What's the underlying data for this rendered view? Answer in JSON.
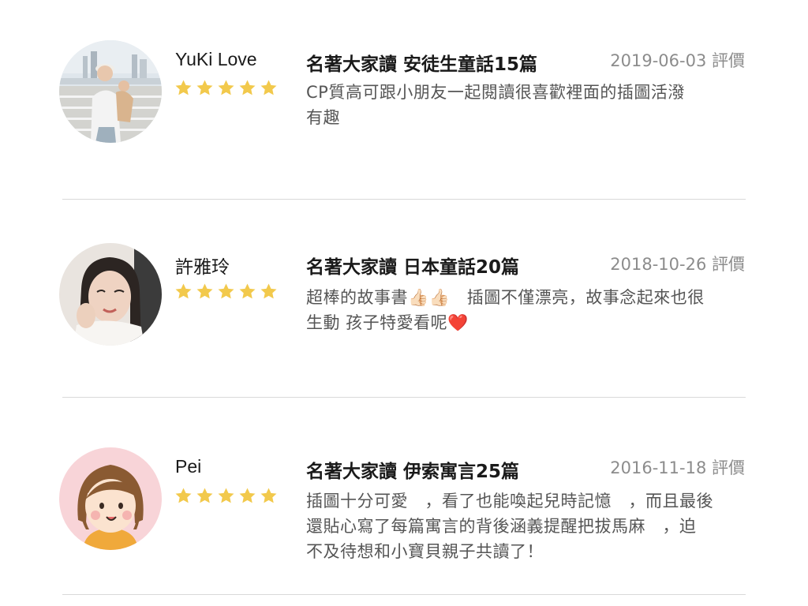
{
  "reviews": [
    {
      "reviewer": "YuKi Love",
      "rating": 5,
      "max_rating": 5,
      "product": "名著大家讀 安徒生童話15篇",
      "date": "2019-06-03",
      "date_suffix": "評價",
      "comment_lines": [
        "CP質高可跟小朋友一起閱讀很喜歡裡面的插圖活潑",
        "有趣"
      ],
      "avatar": "user-photo-woman-holding-child"
    },
    {
      "reviewer": "許雅玲",
      "rating": 5,
      "max_rating": 5,
      "product": "名著大家讀 日本童話20篇",
      "date": "2018-10-26",
      "date_suffix": "評價",
      "comment_lines": [
        "超棒的故事書👍🏻👍🏻　插圖不僅漂亮，故事念起來也很",
        "生動 孩子特愛看呢❤️"
      ],
      "avatar": "user-photo-woman-smiling"
    },
    {
      "reviewer": "Pei",
      "rating": 5,
      "max_rating": 5,
      "product": "名著大家讀 伊索寓言25篇",
      "date": "2016-11-18",
      "date_suffix": "評價",
      "comment_lines": [
        "插圖十分可愛　，看了也能喚起兒時記憶　，而且最後",
        "還貼心寫了每篇寓言的背後涵義提醒把拔馬麻　，迫",
        "不及待想和小寶貝親子共讀了！"
      ],
      "avatar": "cartoon-girl-illustration"
    }
  ],
  "colors": {
    "star": "#f2c94c",
    "divider": "#d9d9d9",
    "name_text": "#1a1a1a",
    "date_text": "#8c8c8c",
    "comment_text": "#555555",
    "cartoon_avatar_bg": "#f8d4d8"
  }
}
